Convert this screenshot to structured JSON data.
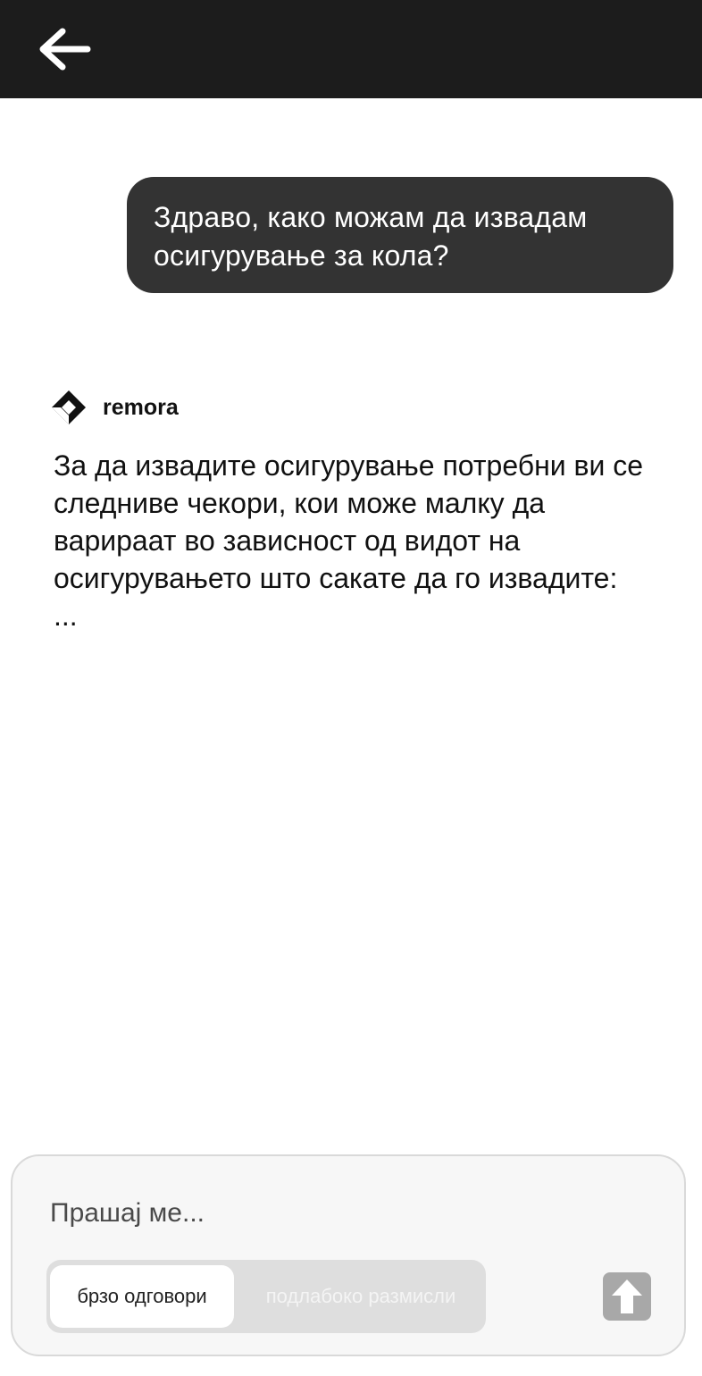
{
  "header": {
    "back_icon": "arrow-left-icon"
  },
  "conversation": {
    "user_message": "Здраво, како можам да извадам осигурување за кола?",
    "assistant": {
      "name": "remora",
      "logo_icon": "remora-logo-icon",
      "message": "За да извадите осигурување потребни ви се следниве чекори, кои може малку да варираат во зависност од видот на осигурувањето што сакате да го извадите:\n..."
    }
  },
  "composer": {
    "placeholder": "Прашај ме...",
    "value": "",
    "modes": [
      {
        "label": "брзо одговори",
        "selected": true
      },
      {
        "label": "подлабоко размисли",
        "selected": false
      }
    ],
    "send_icon": "arrow-up-icon"
  },
  "colors": {
    "topbar": "#1c1c1c",
    "user_bubble": "#333333",
    "send_button": "#a8a8a8"
  }
}
